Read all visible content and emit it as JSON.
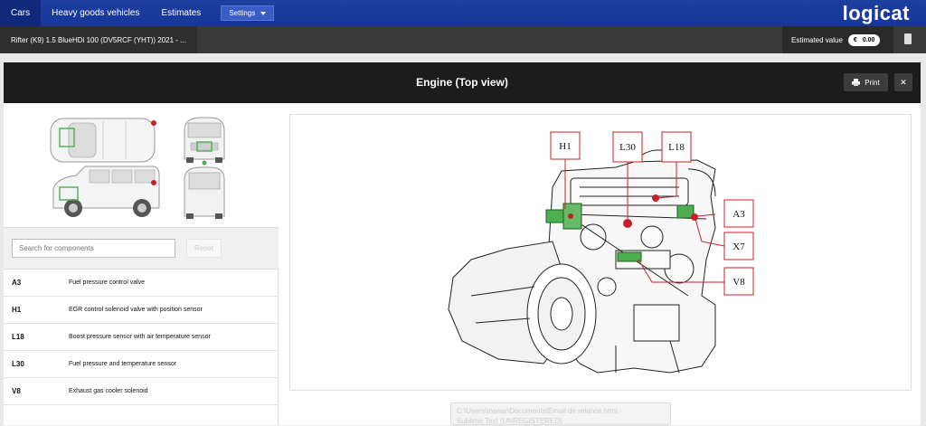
{
  "nav": {
    "tabs": [
      {
        "label": "Cars",
        "active": true
      },
      {
        "label": "Heavy goods vehicles",
        "active": false
      },
      {
        "label": "Estimates",
        "active": false
      }
    ],
    "settings_label": "Settings",
    "logo": "logicat"
  },
  "vehicle": {
    "name": "Rifter (K9) 1.5 BlueHDi 100 (DV5RCF (YHT)) 2021 - ...",
    "estimated_label": "Estimated value",
    "currency": "€",
    "amount": "0.00"
  },
  "modal": {
    "title": "Engine (Top view)",
    "print_label": "Print",
    "close_label": "✕"
  },
  "search": {
    "placeholder": "Search for components",
    "reset_label": "Reset"
  },
  "components": [
    {
      "code": "A3",
      "desc": "Fuel pressure control valve"
    },
    {
      "code": "H1",
      "desc": "EGR control solenoid valve with position sensor"
    },
    {
      "code": "L18",
      "desc": "Boost pressure sensor with air temperature sensor"
    },
    {
      "code": "L30",
      "desc": "Fuel pressure and temperature sensor"
    },
    {
      "code": "V8",
      "desc": "Exhaust gas cooler solenoid"
    }
  ],
  "callouts": [
    "H1",
    "L30",
    "L18",
    "A3",
    "X7",
    "V8"
  ],
  "ghost_window": {
    "line1": "C:\\Users\\manar\\Documents\\Email de relance.html -",
    "line2": "Sublime Text (UNREGISTERED)"
  },
  "colors": {
    "nav_blue": "#1e3f9e",
    "callout_red": "#c8202a",
    "highlight_green": "#4caf50"
  }
}
